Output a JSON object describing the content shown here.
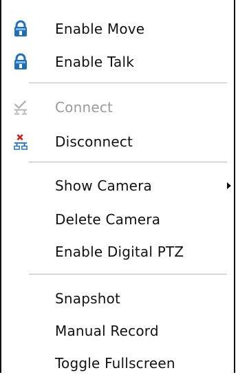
{
  "menu": {
    "items": [
      {
        "label": "Enable Move",
        "icon": "lock-icon"
      },
      {
        "label": "Enable Talk",
        "icon": "lock-icon"
      },
      {
        "label": "Connect",
        "icon": "connect-icon",
        "disabled": true
      },
      {
        "label": "Disconnect",
        "icon": "disconnect-icon"
      },
      {
        "label": "Show Camera",
        "submenu": true
      },
      {
        "label": "Delete Camera"
      },
      {
        "label": "Enable Digital PTZ"
      },
      {
        "label": "Snapshot"
      },
      {
        "label": "Manual Record"
      },
      {
        "label": "Toggle Fullscreen"
      }
    ]
  },
  "colors": {
    "icon_blue": "#1f6fb4",
    "disabled_text": "#9a9a9a",
    "disconnect_red": "#cc1f1f",
    "separator": "#b9b9b9"
  }
}
